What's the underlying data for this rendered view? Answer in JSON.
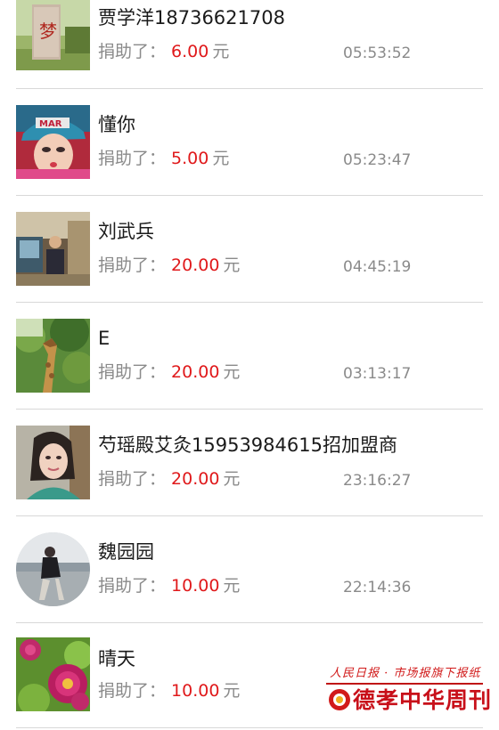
{
  "donations": [
    {
      "name": "贾学洋18736621708",
      "label": "捐助了：",
      "amount": "6.00",
      "unit": "元",
      "time": "05:53:52",
      "avatar": "monument-photo"
    },
    {
      "name": "懂你",
      "label": "捐助了：",
      "amount": "5.00",
      "unit": "元",
      "time": "05:23:47",
      "avatar": "selfie-cap-photo"
    },
    {
      "name": "刘武兵",
      "label": "捐助了：",
      "amount": "20.00",
      "unit": "元",
      "time": "04:45:19",
      "avatar": "man-indoor-photo"
    },
    {
      "name": "E",
      "label": "捐助了：",
      "amount": "20.00",
      "unit": "元",
      "time": "03:13:17",
      "avatar": "giraffe-photo"
    },
    {
      "name": "芍瑶殿艾灸15953984615招加盟商",
      "label": "捐助了：",
      "amount": "20.00",
      "unit": "元",
      "time": "23:16:27",
      "avatar": "woman-portrait-photo"
    },
    {
      "name": "魏园园",
      "label": "捐助了：",
      "amount": "10.00",
      "unit": "元",
      "time": "22:14:36",
      "avatar": "person-lakeside-photo"
    },
    {
      "name": "晴天",
      "label": "捐助了：",
      "amount": "10.00",
      "unit": "元",
      "time": "",
      "avatar": "peony-flower-photo"
    }
  ],
  "watermark": {
    "top_line": "人民日报 · 市场报旗下报纸",
    "main_text": "德孝中华周刊"
  },
  "colors": {
    "amount": "#e0191b",
    "muted_text": "#8a8a8a",
    "divider": "#d8d8d8",
    "watermark": "#c8101a"
  }
}
